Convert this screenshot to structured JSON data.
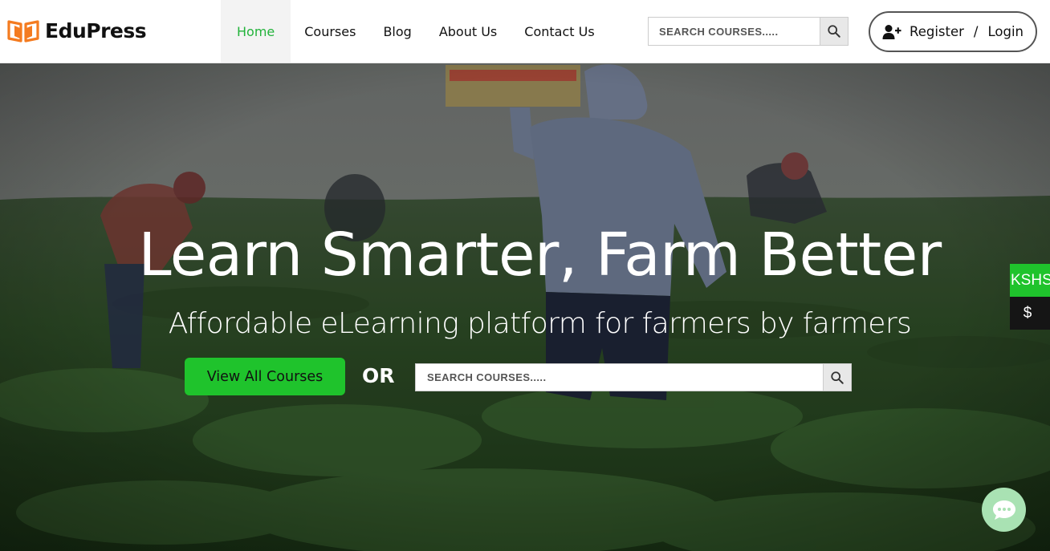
{
  "brand": {
    "name": "EduPress",
    "logo_color": "#f47b20"
  },
  "nav": {
    "items": [
      {
        "label": "Home",
        "active": true
      },
      {
        "label": "Courses"
      },
      {
        "label": "Blog"
      },
      {
        "label": "About Us"
      },
      {
        "label": "Contact Us"
      }
    ]
  },
  "header_search": {
    "placeholder": "SEARCH COURSES....."
  },
  "auth": {
    "register_label": "Register",
    "separator": "/",
    "login_label": "Login"
  },
  "hero": {
    "title": "Learn Smarter, Farm Better",
    "subtitle": "Affordable eLearning platform for farmers by farmers",
    "cta_label": "View All Courses",
    "or_label": "OR",
    "search_placeholder": "SEARCH COURSES....."
  },
  "currency": {
    "primary": "KSHS",
    "secondary": "$"
  },
  "colors": {
    "accent": "#1fc32c",
    "active_nav": "#23b33b",
    "chat": "#a9e2b3"
  },
  "icons": {
    "search": "magnifier-icon",
    "user": "user-plus-icon",
    "chat": "chat-bubble-icon"
  }
}
